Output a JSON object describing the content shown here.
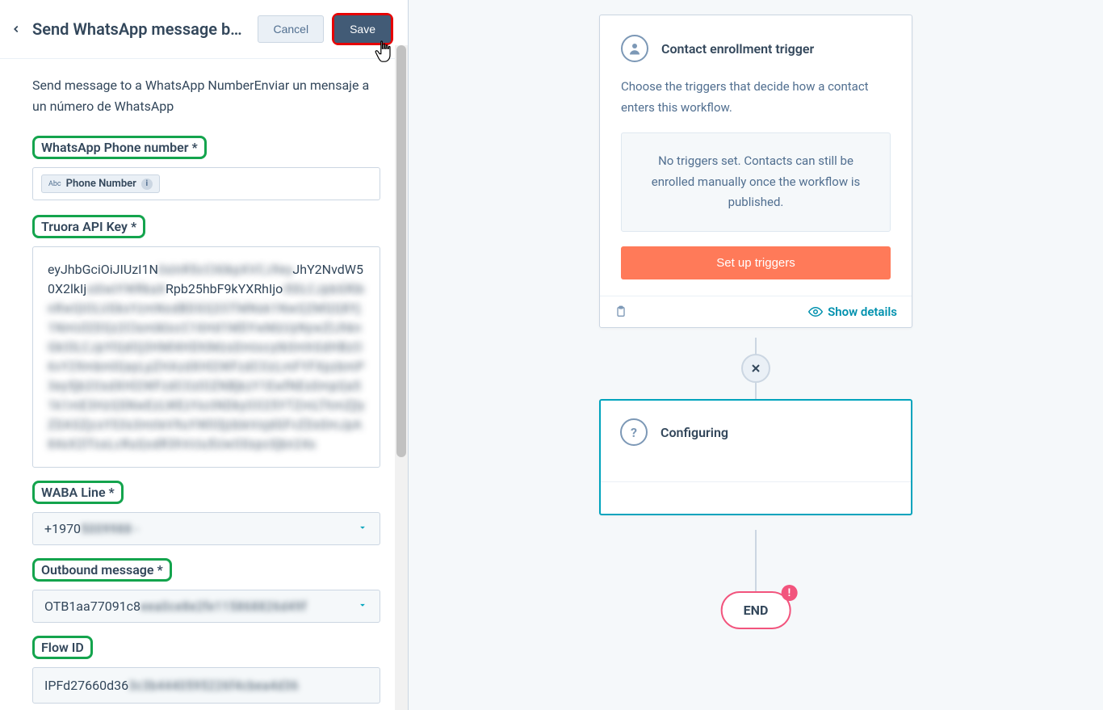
{
  "panel": {
    "title": "Send WhatsApp message by Tr…",
    "cancel": "Cancel",
    "save": "Save",
    "description": "Send message to a WhatsApp NumberEnviar un mensaje a un número de WhatsApp"
  },
  "fields": {
    "phone_label": "WhatsApp Phone number *",
    "phone_token_abc": "Abc",
    "phone_token": "Phone Number",
    "api_label": "Truora API Key *",
    "api_clear1": "eyJhbGciOiJIUzI1N",
    "api_blur1": "iIsInR5cCI6IkpXVCJ9ey",
    "api_clear2": "JhY2NvdW50X2lkIj",
    "api_blur2": "oiIiwiYWRkaX",
    "api_clear3": "Rpb25hbF9kYXRhIjo",
    "api_blur3": "i50LCJpbGRibnRwQiOLUGkxY",
    "api_blurbig": "zmNodBDGQ2OTMNsk1NwQ2MQQ8Yj1NmUl2DQz2ClsmiklocC16Hd1MDYwMzUyNywZlJhknGkOlLCJpYlQdOj3HMl4HDhlMzsDmiocytk0mhGdHBzO6vY29mbmlQayLpZHAzdXHl2WFzdCOzLmFYFXpzbmP3ey5jb2OsdXHl2WFzdCOzlOZNBjkzY1EwfNEs0mpQa51k1mE3HzQSNwEzLWEzYsctNDkyOO25YTZmLThmZjlyZDASZjcxYS3s3mrleV9uYWlOljzbleVojdGFvZDx0mJpA84xX2lToxLcRuQodR3hVcIu5UwO0xpc0jbn24s",
    "waba_label": "WABA Line *",
    "waba_clear": "+1970",
    "waba_blur": "5009988 -",
    "outbound_label": "Outbound message *",
    "outbound_clear": "OTB1aa77091c8",
    "outbound_blur": "eea0ce8e2fe115868826d49f",
    "flow_label": "Flow ID",
    "flow_clear": "IPFd27660d36",
    "flow_blur": "3c3b4440595226f4cbea4d36"
  },
  "canvas": {
    "trigger_title": "Contact enrollment trigger",
    "trigger_desc": "Choose the triggers that decide how a contact enters this workflow.",
    "trigger_empty": "No triggers set. Contacts can still be enrolled manually once the workflow is published.",
    "setup_btn": "Set up triggers",
    "show_details": "Show details",
    "configuring": "Configuring",
    "end": "END",
    "end_badge": "!"
  }
}
